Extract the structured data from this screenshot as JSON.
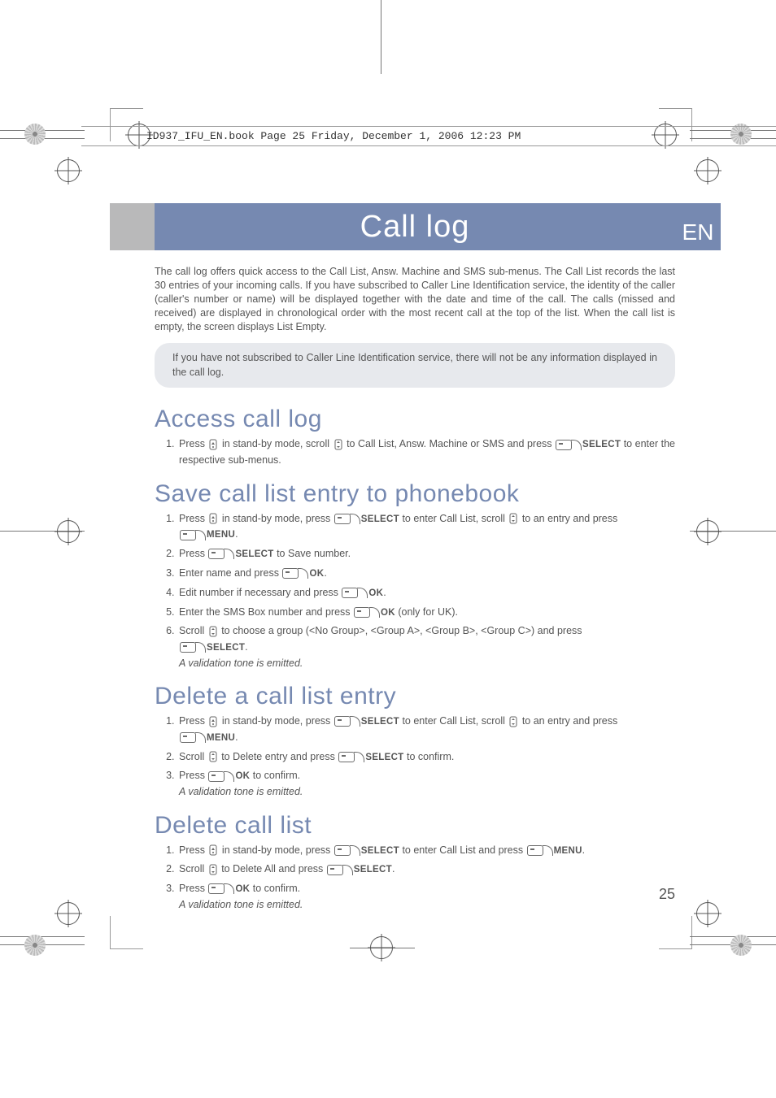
{
  "meta": {
    "header_strip": "ID937_IFU_EN.book  Page 25  Friday, December 1, 2006  12:23 PM"
  },
  "title": {
    "main": "Call log",
    "lang": "EN"
  },
  "intro": "The call log offers quick access to the Call List, Answ. Machine and SMS sub-menus. The Call List records the last 30 entries of your incoming calls. If you have subscribed to Caller Line Identification service, the identity of the caller (caller's number or name) will be displayed together with the date and time of the call. The calls (missed and received) are displayed in chronological order with the most recent call at the top of the list. When the call list is empty, the screen displays List Empty.",
  "note": "If you have not subscribed to Caller Line Identification service, there will not be any information displayed in the call log.",
  "sections": {
    "access": {
      "heading": "Access call log",
      "step1_a": "Press ",
      "step1_b": " in stand-by mode, scroll ",
      "step1_c": " to Call List, Answ. Machine or SMS and press ",
      "step1_label": "SELECT",
      "step1_d": " to enter the respective sub-menus."
    },
    "save": {
      "heading": "Save call list entry to phonebook",
      "s1_a": "Press ",
      "s1_b": " in stand-by mode, press ",
      "s1_lab1": "SELECT",
      "s1_c": " to enter Call List, scroll ",
      "s1_d": " to an entry and press ",
      "s1_lab2": "MENU",
      "s1_e": ".",
      "s2_a": "Press ",
      "s2_lab": "SELECT",
      "s2_b": " to Save number.",
      "s3_a": "Enter name and press ",
      "s3_lab": "OK",
      "s3_b": ".",
      "s4_a": "Edit number if necessary and press ",
      "s4_lab": "OK",
      "s4_b": ".",
      "s5_a": "Enter the SMS Box number and press ",
      "s5_lab": "OK",
      "s5_b": " (only for UK).",
      "s6_a": "Scroll ",
      "s6_b": " to choose a group (<No Group>, <Group A>, <Group B>, <Group C>) and press ",
      "s6_lab": "SELECT",
      "s6_c": ".",
      "s6_tone": "A validation tone is emitted."
    },
    "delete_entry": {
      "heading": "Delete a call list entry",
      "s1_a": "Press ",
      "s1_b": " in stand-by mode, press ",
      "s1_lab1": "SELECT",
      "s1_c": " to enter Call List, scroll ",
      "s1_d": " to an entry and press ",
      "s1_lab2": "MENU",
      "s1_e": ".",
      "s2_a": "Scroll ",
      "s2_b": " to Delete entry and press ",
      "s2_lab": "SELECT",
      "s2_c": " to confirm.",
      "s3_a": "Press ",
      "s3_lab": "OK",
      "s3_b": " to confirm.",
      "s3_tone": "A validation tone is emitted."
    },
    "delete_list": {
      "heading": "Delete call list",
      "s1_a": "Press ",
      "s1_b": " in stand-by mode, press ",
      "s1_lab1": "SELECT",
      "s1_c": " to enter Call List and press ",
      "s1_lab2": "MENU",
      "s1_d": ".",
      "s2_a": "Scroll ",
      "s2_b": " to Delete All and press ",
      "s2_lab": "SELECT",
      "s2_c": ".",
      "s3_a": "Press ",
      "s3_lab": "OK",
      "s3_b": " to confirm.",
      "s3_tone": "A validation tone is emitted."
    }
  },
  "page_number": "25"
}
